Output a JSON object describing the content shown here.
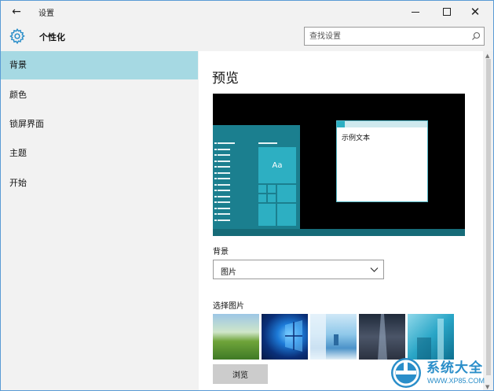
{
  "window": {
    "title": "设置",
    "back_glyph": "←",
    "minimize_glyph": "—",
    "close_glyph": "✕"
  },
  "header": {
    "page_title": "个性化",
    "search_placeholder": "查找设置"
  },
  "sidebar": {
    "items": [
      {
        "label": "背景",
        "active": true
      },
      {
        "label": "颜色",
        "active": false
      },
      {
        "label": "锁屏界面",
        "active": false
      },
      {
        "label": "主题",
        "active": false
      },
      {
        "label": "开始",
        "active": false
      }
    ]
  },
  "main": {
    "section_title": "预览",
    "preview": {
      "tile_text": "Aa",
      "sample_window_text": "示例文本"
    },
    "background_label": "背景",
    "background_select_value": "图片",
    "choose_label": "选择图片",
    "browse_button": "浏览"
  },
  "watermark": {
    "title": "系统大全",
    "url": "WWW.XP85.COM"
  },
  "colors": {
    "accent_selection": "#a6d9e3",
    "preview_teal": "#1b7f8f",
    "tile_teal": "#2dafc2"
  },
  "icons": [
    "back-arrow-icon",
    "gear-icon",
    "search-icon",
    "chevron-down-icon",
    "minimize-icon",
    "maximize-icon",
    "close-icon"
  ]
}
